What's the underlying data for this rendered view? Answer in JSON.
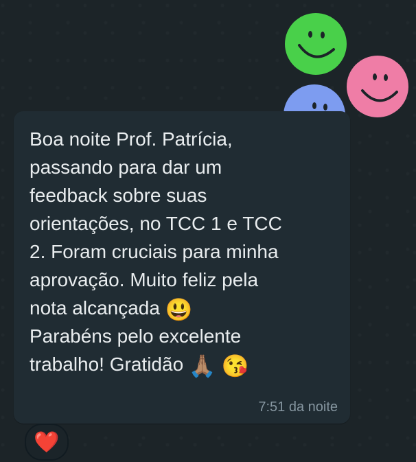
{
  "message": {
    "lines": [
      "Boa noite Prof. Patrícia,",
      "passando para dar um",
      "feedback sobre suas",
      "orientações, no TCC 1 e TCC",
      "2. Foram cruciais para minha",
      "aprovação. Muito feliz pela",
      "nota alcançada",
      "Parabéns pelo excelente",
      "trabalho! Gratidão"
    ],
    "emoji_grin": "😃",
    "emoji_pray": "🙏🏽",
    "emoji_kiss": "😘",
    "timestamp": "7:51 da noite"
  },
  "reaction": {
    "emoji": "❤️"
  },
  "stickers": {
    "colors": [
      "#49d04a",
      "#ef7da6",
      "#7d9cf0"
    ],
    "icon": "smiley-face-icon"
  }
}
